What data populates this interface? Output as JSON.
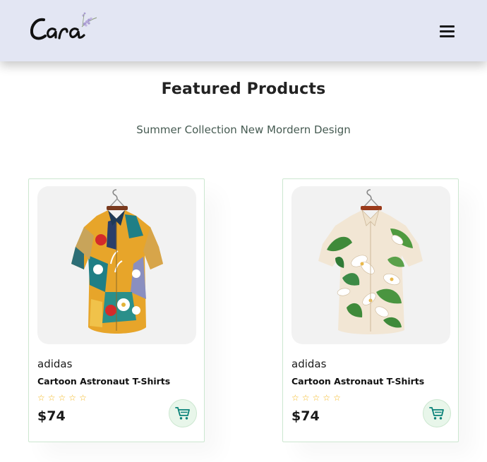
{
  "header": {
    "logo_text": "Cara",
    "menu_icon": "hamburger-menu-icon"
  },
  "featured": {
    "title": "Featured Products",
    "subtitle": "Summer Collection New Mordern Design"
  },
  "products": [
    {
      "brand": "adidas",
      "name": "Cartoon Astronaut T-Shirts",
      "rating_stars": 5,
      "price": "$74",
      "image": "colorful-abstract-print-shirt",
      "cart_icon": "cart-icon"
    },
    {
      "brand": "adidas",
      "name": "Cartoon Astronaut T-Shirts",
      "rating_stars": 5,
      "price": "$74",
      "image": "floral-print-shirt",
      "cart_icon": "cart-icon"
    }
  ],
  "colors": {
    "header_bg": "#e3e6f3",
    "accent": "#088178",
    "star": "#f3b519",
    "card_border": "#cce7d0"
  }
}
